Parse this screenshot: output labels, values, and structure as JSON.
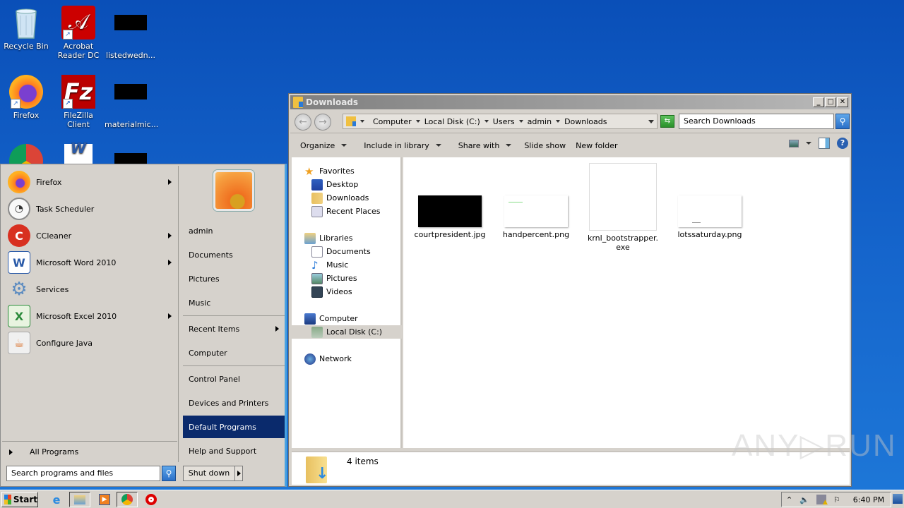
{
  "desktop": {
    "icons": [
      {
        "label": "Recycle Bin",
        "icon": "recycle-bin-icon"
      },
      {
        "label": "Acrobat Reader DC",
        "icon": "acrobat-icon"
      },
      {
        "label": "listedwedn...",
        "icon": "file-thumbnail-icon"
      },
      {
        "label": "Firefox",
        "icon": "firefox-icon"
      },
      {
        "label": "FileZilla Client",
        "icon": "filezilla-icon"
      },
      {
        "label": "materialmic...",
        "icon": "file-thumbnail-icon"
      },
      {
        "label": "",
        "icon": "chrome-icon"
      },
      {
        "label": "",
        "icon": "word-document-icon"
      }
    ]
  },
  "start_menu": {
    "programs": [
      {
        "label": "Firefox",
        "has_submenu": true
      },
      {
        "label": "Task Scheduler",
        "has_submenu": false
      },
      {
        "label": "CCleaner",
        "has_submenu": true
      },
      {
        "label": "Microsoft Word 2010",
        "has_submenu": true
      },
      {
        "label": "Services",
        "has_submenu": false
      },
      {
        "label": "Microsoft Excel 2010",
        "has_submenu": true
      },
      {
        "label": "Configure Java",
        "has_submenu": false
      }
    ],
    "all_programs": "All Programs",
    "search_placeholder": "Search programs and files",
    "right_items": [
      {
        "label": "admin"
      },
      {
        "label": "Documents"
      },
      {
        "label": "Pictures"
      },
      {
        "label": "Music"
      },
      {
        "label": "Recent Items",
        "has_submenu": true
      },
      {
        "label": "Computer"
      },
      {
        "label": "Control Panel"
      },
      {
        "label": "Devices and Printers"
      },
      {
        "label": "Default Programs",
        "selected": true
      },
      {
        "label": "Help and Support"
      }
    ],
    "shutdown_label": "Shut down"
  },
  "explorer": {
    "title": "Downloads",
    "breadcrumb": [
      "Computer",
      "Local Disk (C:)",
      "Users",
      "admin",
      "Downloads"
    ],
    "search_placeholder": "Search Downloads",
    "toolbar": [
      {
        "label": "Organize",
        "dropdown": true
      },
      {
        "label": "Include in library",
        "dropdown": true
      },
      {
        "label": "Share with",
        "dropdown": true
      },
      {
        "label": "Slide show",
        "dropdown": false
      },
      {
        "label": "New folder",
        "dropdown": false
      }
    ],
    "nav_pane": [
      {
        "label": "Favorites",
        "level": 0,
        "icon": "star-icon"
      },
      {
        "label": "Desktop",
        "level": 1,
        "icon": "desktop-icon"
      },
      {
        "label": "Downloads",
        "level": 1,
        "icon": "downloads-folder-icon"
      },
      {
        "label": "Recent Places",
        "level": 1,
        "icon": "recent-places-icon"
      },
      {
        "label": "Libraries",
        "level": 0,
        "icon": "libraries-icon"
      },
      {
        "label": "Documents",
        "level": 1,
        "icon": "documents-icon"
      },
      {
        "label": "Music",
        "level": 1,
        "icon": "music-icon"
      },
      {
        "label": "Pictures",
        "level": 1,
        "icon": "pictures-icon"
      },
      {
        "label": "Videos",
        "level": 1,
        "icon": "videos-icon"
      },
      {
        "label": "Computer",
        "level": 0,
        "icon": "computer-icon"
      },
      {
        "label": "Local Disk (C:)",
        "level": 1,
        "icon": "local-disk-icon",
        "selected": true
      },
      {
        "label": "Network",
        "level": 0,
        "icon": "network-icon"
      }
    ],
    "files": [
      {
        "name": "courtpresident.jpg",
        "thumb": "dark-image"
      },
      {
        "name": "handpercent.png",
        "thumb": "light-image"
      },
      {
        "name": "krnl_bootstrapper.exe",
        "name_line1": "krnl_bootstrapper.",
        "name_line2": "exe",
        "thumb": "blank-exe"
      },
      {
        "name": "lotssaturday.png",
        "thumb": "light-image"
      }
    ],
    "status": "4 items"
  },
  "taskbar": {
    "start_label": "Start",
    "clock": "6:40 PM",
    "pinned": [
      "internet-explorer-icon",
      "explorer-icon",
      "media-player-icon",
      "chrome-icon",
      "opera-icon"
    ]
  },
  "watermark": "ANY▷RUN",
  "colors": {
    "desktop_bg": "#1565cc",
    "selection": "#0a2a6c",
    "menu_bg": "#d6d2cc"
  }
}
